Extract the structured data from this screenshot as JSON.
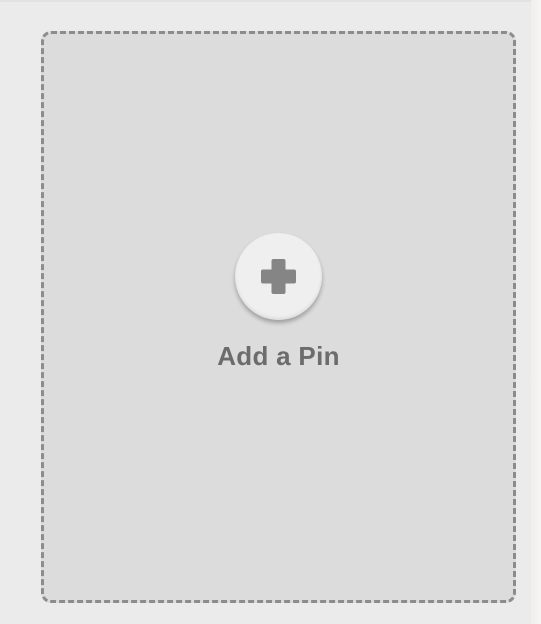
{
  "add_pin": {
    "label": "Add a Pin",
    "icon": "plus-icon",
    "colors": {
      "page_background": "#ebebeb",
      "card_background": "#dcdcdc",
      "dashed_border": "#8c8c8c",
      "button_background": "#efefef",
      "icon": "#858585",
      "label_text": "#6c6c6c"
    }
  }
}
